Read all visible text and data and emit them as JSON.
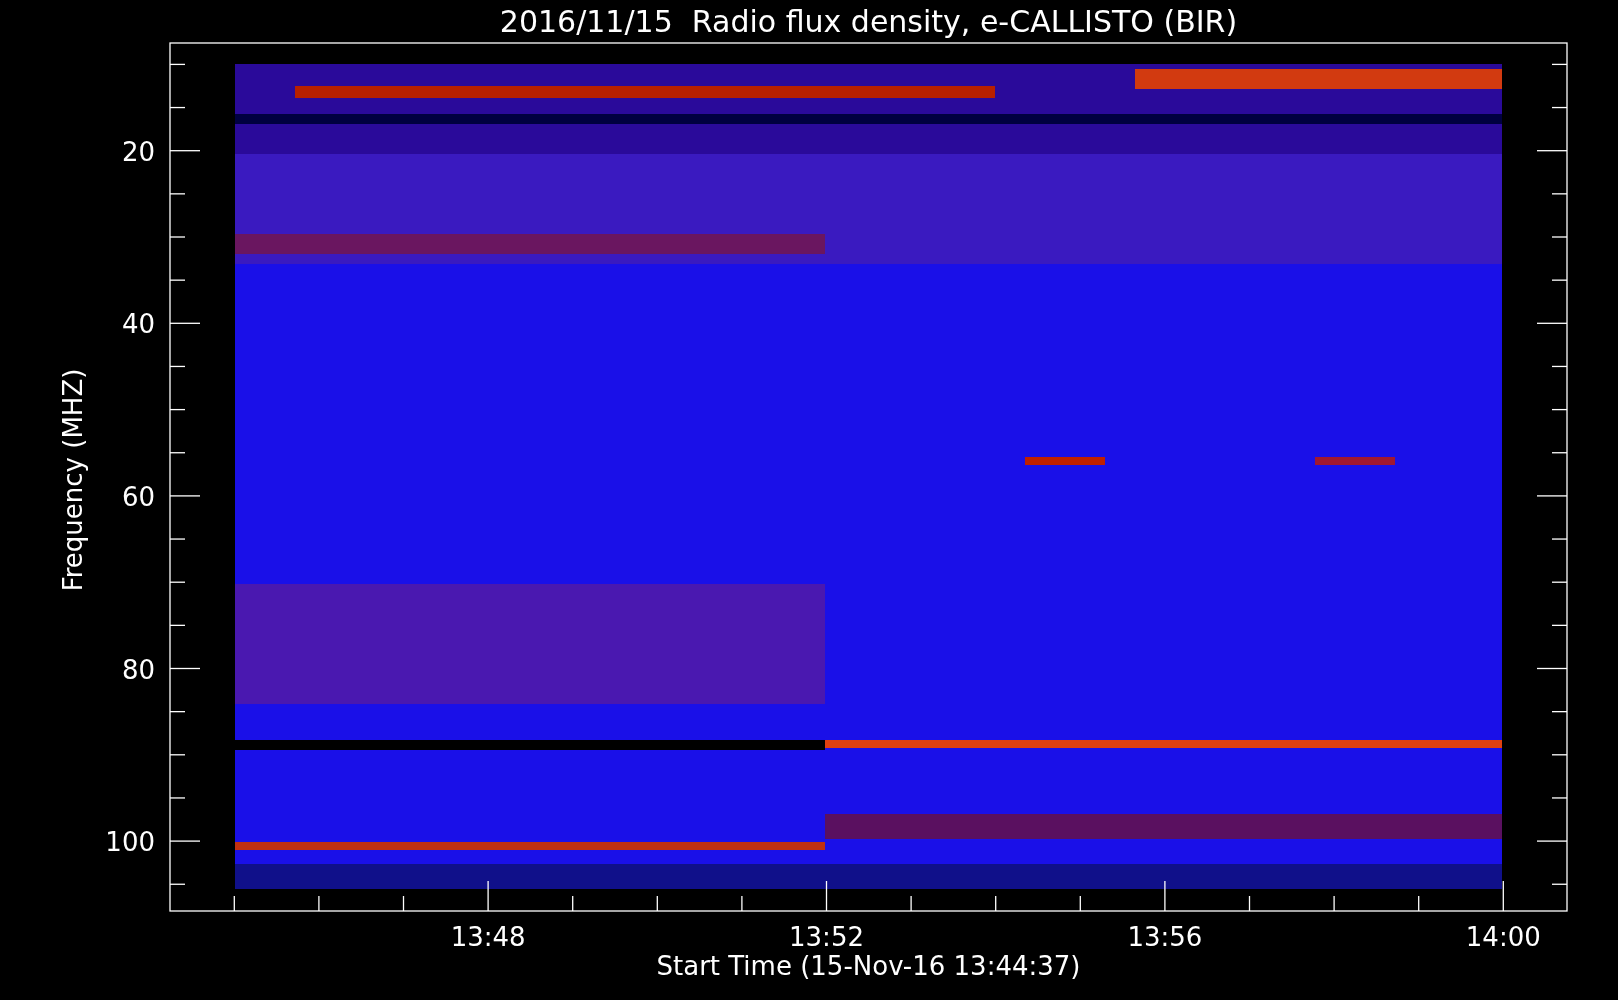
{
  "title": "2016/11/15  Radio flux density, e-CALLISTO (BIR)",
  "axes": {
    "xlabel": "Start Time (15-Nov-16 13:44:37)",
    "ylabel": "Frequency (MHZ)",
    "xticks": [
      "13:48",
      "13:52",
      "13:56",
      "14:00"
    ],
    "yticks": [
      "20",
      "40",
      "60",
      "80",
      "100"
    ]
  }
}
